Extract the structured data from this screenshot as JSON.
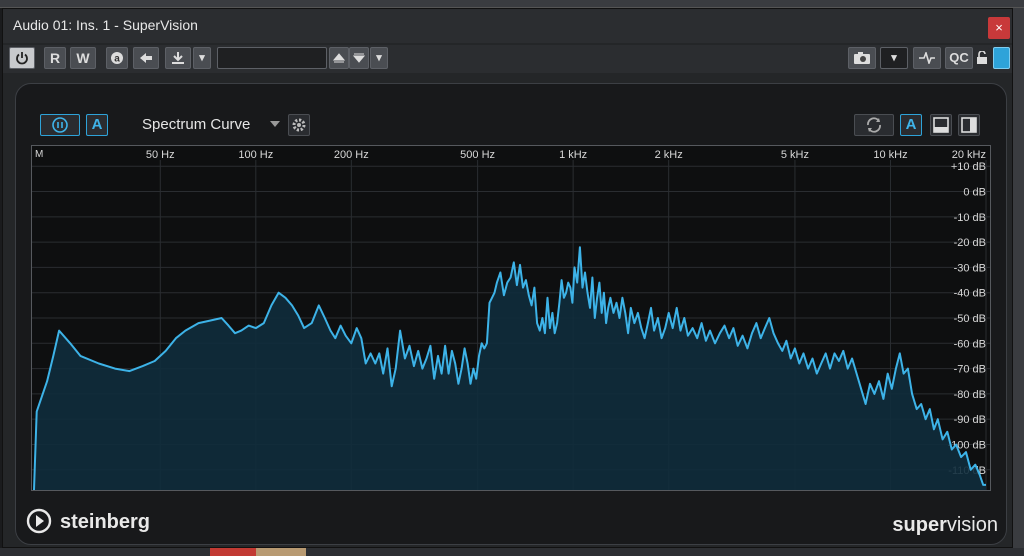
{
  "window": {
    "title": "Audio 01: Ins. 1 - SuperVision",
    "close_label": "×"
  },
  "toolbar": {
    "read_label": "R",
    "write_label": "W",
    "qc_label": "QC",
    "preset_value": ""
  },
  "plugin": {
    "module": "Spectrum Curve",
    "auto_label_left": "A",
    "auto_label_right": "A"
  },
  "chart_data": {
    "type": "line",
    "corner_label": "M",
    "x_scale": "log",
    "x_unit": "Hz",
    "x_range": [
      20,
      20000
    ],
    "x_ticks": [
      {
        "value": 50,
        "label": "50 Hz"
      },
      {
        "value": 100,
        "label": "100 Hz"
      },
      {
        "value": 200,
        "label": "200 Hz"
      },
      {
        "value": 500,
        "label": "500 Hz"
      },
      {
        "value": 1000,
        "label": "1 kHz"
      },
      {
        "value": 2000,
        "label": "2 kHz"
      },
      {
        "value": 5000,
        "label": "5 kHz"
      },
      {
        "value": 10000,
        "label": "10 kHz"
      },
      {
        "value": 20000,
        "label": "20 kHz"
      }
    ],
    "y_range": [
      -118,
      18
    ],
    "y_ticks": [
      {
        "value": 10,
        "label": "+10 dB"
      },
      {
        "value": 0,
        "label": "0 dB"
      },
      {
        "value": -10,
        "label": "-10 dB"
      },
      {
        "value": -20,
        "label": "-20 dB"
      },
      {
        "value": -30,
        "label": "-30 dB"
      },
      {
        "value": -40,
        "label": "-40 dB"
      },
      {
        "value": -50,
        "label": "-50 dB"
      },
      {
        "value": -60,
        "label": "-60 dB"
      },
      {
        "value": -70,
        "label": "-70 dB"
      },
      {
        "value": -80,
        "label": "-80 dB"
      },
      {
        "value": -90,
        "label": "-90 dB"
      },
      {
        "value": -100,
        "label": "-100 dB"
      },
      {
        "value": -110,
        "label": "-110 dB"
      }
    ],
    "grid": true,
    "colors": {
      "curve": "#3db3e8",
      "fill": "#0f2c3c",
      "grid": "#2a2d31"
    },
    "series": [
      {
        "points": [
          [
            20,
            -118
          ],
          [
            20.4,
            -87
          ],
          [
            22,
            -75
          ],
          [
            23,
            -65
          ],
          [
            24,
            -55
          ],
          [
            26,
            -60
          ],
          [
            28,
            -65
          ],
          [
            32,
            -68
          ],
          [
            36,
            -70
          ],
          [
            40,
            -71
          ],
          [
            44,
            -69
          ],
          [
            48,
            -67
          ],
          [
            52,
            -63
          ],
          [
            56,
            -58
          ],
          [
            60,
            -55
          ],
          [
            66,
            -52
          ],
          [
            72,
            -51
          ],
          [
            78,
            -50
          ],
          [
            82,
            -53
          ],
          [
            86,
            -56
          ],
          [
            90,
            -55
          ],
          [
            95,
            -53
          ],
          [
            100,
            -54
          ],
          [
            106,
            -52
          ],
          [
            112,
            -45
          ],
          [
            118,
            -40
          ],
          [
            124,
            -42
          ],
          [
            130,
            -45
          ],
          [
            136,
            -49
          ],
          [
            142,
            -54
          ],
          [
            150,
            -52
          ],
          [
            158,
            -45
          ],
          [
            165,
            -50
          ],
          [
            172,
            -55
          ],
          [
            178,
            -58
          ],
          [
            185,
            -53
          ],
          [
            192,
            -57
          ],
          [
            200,
            -60
          ],
          [
            208,
            -54
          ],
          [
            215,
            -58
          ],
          [
            222,
            -68
          ],
          [
            230,
            -64
          ],
          [
            238,
            -68
          ],
          [
            245,
            -64
          ],
          [
            252,
            -72
          ],
          [
            260,
            -62
          ],
          [
            268,
            -77
          ],
          [
            276,
            -70
          ],
          [
            285,
            -55
          ],
          [
            295,
            -66
          ],
          [
            305,
            -61
          ],
          [
            315,
            -69
          ],
          [
            325,
            -63
          ],
          [
            335,
            -70
          ],
          [
            345,
            -66
          ],
          [
            355,
            -61
          ],
          [
            365,
            -74
          ],
          [
            375,
            -65
          ],
          [
            385,
            -72
          ],
          [
            395,
            -61
          ],
          [
            405,
            -72
          ],
          [
            415,
            -63
          ],
          [
            425,
            -68
          ],
          [
            435,
            -76
          ],
          [
            445,
            -70
          ],
          [
            455,
            -62
          ],
          [
            465,
            -68
          ],
          [
            475,
            -76
          ],
          [
            485,
            -70
          ],
          [
            495,
            -74
          ],
          [
            505,
            -65
          ],
          [
            515,
            -60
          ],
          [
            525,
            -62
          ],
          [
            535,
            -60
          ],
          [
            545,
            -44
          ],
          [
            555,
            -42
          ],
          [
            565,
            -40
          ],
          [
            575,
            -36
          ],
          [
            590,
            -32
          ],
          [
            605,
            -41
          ],
          [
            620,
            -36
          ],
          [
            635,
            -34
          ],
          [
            650,
            -28
          ],
          [
            665,
            -37
          ],
          [
            680,
            -29
          ],
          [
            695,
            -38
          ],
          [
            710,
            -35
          ],
          [
            725,
            -41
          ],
          [
            740,
            -45
          ],
          [
            755,
            -38
          ],
          [
            770,
            -52
          ],
          [
            785,
            -55
          ],
          [
            800,
            -50
          ],
          [
            815,
            -56
          ],
          [
            830,
            -42
          ],
          [
            845,
            -54
          ],
          [
            860,
            -48
          ],
          [
            875,
            -56
          ],
          [
            890,
            -52
          ],
          [
            905,
            -44
          ],
          [
            920,
            -35
          ],
          [
            935,
            -42
          ],
          [
            950,
            -40
          ],
          [
            965,
            -36
          ],
          [
            980,
            -38
          ],
          [
            995,
            -44
          ],
          [
            1010,
            -30
          ],
          [
            1030,
            -36
          ],
          [
            1050,
            -22
          ],
          [
            1070,
            -38
          ],
          [
            1090,
            -32
          ],
          [
            1110,
            -40
          ],
          [
            1130,
            -46
          ],
          [
            1150,
            -34
          ],
          [
            1170,
            -50
          ],
          [
            1190,
            -42
          ],
          [
            1210,
            -36
          ],
          [
            1230,
            -48
          ],
          [
            1250,
            -40
          ],
          [
            1270,
            -52
          ],
          [
            1290,
            -46
          ],
          [
            1310,
            -42
          ],
          [
            1340,
            -48
          ],
          [
            1370,
            -44
          ],
          [
            1400,
            -50
          ],
          [
            1430,
            -42
          ],
          [
            1460,
            -48
          ],
          [
            1490,
            -56
          ],
          [
            1520,
            -46
          ],
          [
            1560,
            -52
          ],
          [
            1600,
            -48
          ],
          [
            1640,
            -54
          ],
          [
            1680,
            -58
          ],
          [
            1720,
            -52
          ],
          [
            1760,
            -46
          ],
          [
            1800,
            -55
          ],
          [
            1850,
            -50
          ],
          [
            1900,
            -58
          ],
          [
            1950,
            -54
          ],
          [
            2000,
            -48
          ],
          [
            2060,
            -54
          ],
          [
            2120,
            -46
          ],
          [
            2180,
            -55
          ],
          [
            2240,
            -50
          ],
          [
            2300,
            -57
          ],
          [
            2380,
            -54
          ],
          [
            2460,
            -58
          ],
          [
            2540,
            -52
          ],
          [
            2620,
            -59
          ],
          [
            2700,
            -55
          ],
          [
            2800,
            -60
          ],
          [
            2900,
            -56
          ],
          [
            3000,
            -53
          ],
          [
            3100,
            -58
          ],
          [
            3200,
            -54
          ],
          [
            3300,
            -61
          ],
          [
            3420,
            -57
          ],
          [
            3540,
            -62
          ],
          [
            3660,
            -56
          ],
          [
            3780,
            -52
          ],
          [
            3900,
            -58
          ],
          [
            4020,
            -54
          ],
          [
            4150,
            -50
          ],
          [
            4280,
            -56
          ],
          [
            4420,
            -60
          ],
          [
            4560,
            -63
          ],
          [
            4700,
            -59
          ],
          [
            4850,
            -66
          ],
          [
            5000,
            -62
          ],
          [
            5160,
            -68
          ],
          [
            5320,
            -64
          ],
          [
            5500,
            -70
          ],
          [
            5680,
            -66
          ],
          [
            5860,
            -72
          ],
          [
            6050,
            -68
          ],
          [
            6250,
            -64
          ],
          [
            6450,
            -70
          ],
          [
            6660,
            -64
          ],
          [
            6880,
            -67
          ],
          [
            7100,
            -63
          ],
          [
            7330,
            -70
          ],
          [
            7570,
            -66
          ],
          [
            7820,
            -72
          ],
          [
            8080,
            -78
          ],
          [
            8350,
            -84
          ],
          [
            8620,
            -76
          ],
          [
            8900,
            -80
          ],
          [
            9200,
            -75
          ],
          [
            9500,
            -82
          ],
          [
            9800,
            -72
          ],
          [
            10100,
            -78
          ],
          [
            10400,
            -70
          ],
          [
            10700,
            -64
          ],
          [
            11000,
            -72
          ],
          [
            11350,
            -70
          ],
          [
            11700,
            -80
          ],
          [
            12100,
            -86
          ],
          [
            12500,
            -84
          ],
          [
            12900,
            -90
          ],
          [
            13300,
            -86
          ],
          [
            13700,
            -94
          ],
          [
            14100,
            -90
          ],
          [
            14600,
            -98
          ],
          [
            15100,
            -95
          ],
          [
            15600,
            -102
          ],
          [
            16100,
            -100
          ],
          [
            16700,
            -105
          ],
          [
            17300,
            -103
          ],
          [
            17900,
            -110
          ],
          [
            18500,
            -108
          ],
          [
            19100,
            -112
          ],
          [
            19600,
            -116
          ],
          [
            20000,
            -116
          ]
        ]
      }
    ]
  }
}
